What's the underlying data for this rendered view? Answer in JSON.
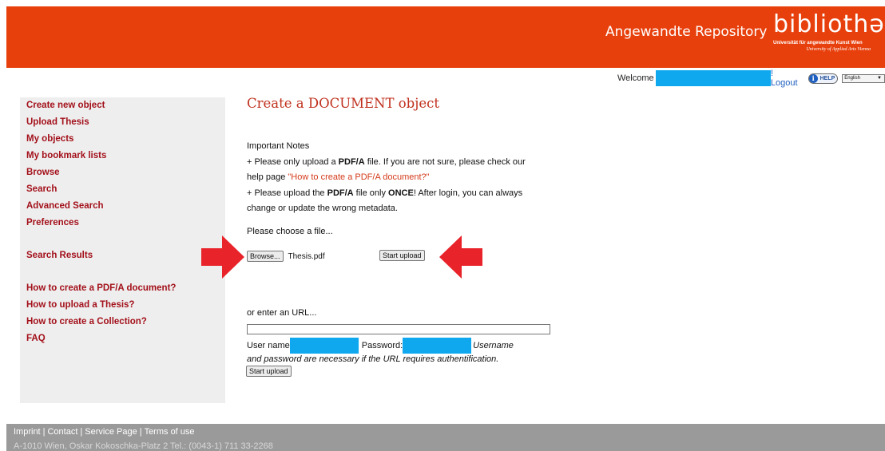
{
  "header": {
    "repo_title": "Angewandte Repository",
    "logo_main": "bibliothək",
    "logo_sub1": "Universität für angewandte Kunst Wien",
    "logo_sub2": "University of Applied Arts Vienna",
    "color": "#e8400c"
  },
  "userbar": {
    "welcome": "Welcome",
    "logout": "! Logout",
    "help": "HELP",
    "language": "English"
  },
  "sidebar": {
    "group1": [
      "Create new object",
      "Upload Thesis",
      "My objects",
      "My bookmark lists",
      "Browse",
      "Search",
      "Advanced Search",
      "Preferences"
    ],
    "group2": [
      "Search Results"
    ],
    "group3": [
      "How to create a PDF/A document?",
      "How to upload a Thesis?",
      "How to create a Collection?",
      "FAQ"
    ]
  },
  "main": {
    "title": "Create a DOCUMENT object",
    "notes_heading": "Important Notes",
    "note1_pre": "+ Please only upload a ",
    "note1_bold": "PDF/A",
    "note1_post": " file. If you are not sure, please check our",
    "note2_pre": "help page ",
    "note2_link": "\"How to create a PDF/A document?\"",
    "note3_pre": "+ Please upload the ",
    "note3_bold1": "PDF/A",
    "note3_mid": " file only ",
    "note3_bold2": "ONCE",
    "note3_post": "! After login, you can always",
    "note4": "change or update the wrong metadata.",
    "choose_file": "Please choose a file...",
    "browse_label": "Browse...",
    "filename": "Thesis.pdf",
    "start_upload": "Start upload",
    "or_url": "or enter an URL...",
    "url_value": "",
    "user_name_label": "User name",
    "password_label": "Password:",
    "auth_note1": "Username",
    "auth_note2": "and password are necessary if the URL requires authentification.",
    "start_upload_2": "Start upload"
  },
  "footer": {
    "links": [
      "Imprint",
      "Contact",
      "Service Page",
      "Terms of use"
    ],
    "address": "A-1010 Wien, Oskar Kokoschka-Platz 2 Tel.: (0043-1) 711 33-2268"
  },
  "colors": {
    "accent": "#e8400c",
    "nav_text": "#a3101a",
    "redaction": "#0fa8ef",
    "arrow": "#e8232a"
  }
}
